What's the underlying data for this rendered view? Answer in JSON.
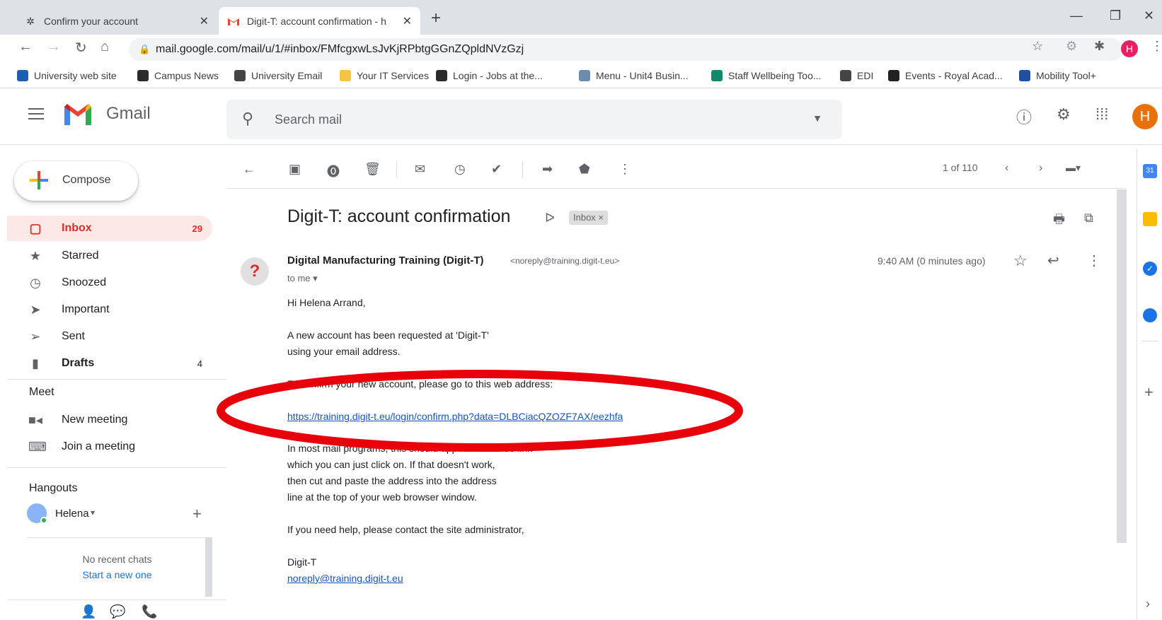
{
  "browser": {
    "tabs": [
      {
        "title": "Confirm your account",
        "icon": "settings-favicon"
      },
      {
        "title": "Digit-T: account confirmation - h",
        "icon": "gmail-favicon"
      }
    ],
    "url": "mail.google.com/mail/u/1/#inbox/FMfcgxwLsJvKjRPbtgGGnZQpldNVzGzj",
    "profile_initial": "H",
    "bookmarks": [
      {
        "label": "University web site",
        "color": "#1a5fb4"
      },
      {
        "label": "Campus News",
        "color": "#2b2b2b"
      },
      {
        "label": "University Email",
        "color": "#444444"
      },
      {
        "label": "Your IT Services",
        "color": "#f4c542"
      },
      {
        "label": "Login - Jobs at the...",
        "color": "#2b2b2b"
      },
      {
        "label": "Menu - Unit4 Busin...",
        "color": "#6a8caf"
      },
      {
        "label": "Staff Wellbeing Too...",
        "color": "#108a6a"
      },
      {
        "label": "EDI",
        "color": "#444444"
      },
      {
        "label": "Events - Royal Acad...",
        "color": "#222222"
      },
      {
        "label": "Mobility Tool+",
        "color": "#1f4fa0"
      }
    ]
  },
  "gmail": {
    "brand": "Gmail",
    "search_placeholder": "Search mail",
    "avatar_initial": "H",
    "compose_label": "Compose",
    "nav": [
      {
        "label": "Inbox",
        "count": "29",
        "icon": "inbox-icon"
      },
      {
        "label": "Starred",
        "count": "",
        "icon": "star-icon"
      },
      {
        "label": "Snoozed",
        "count": "",
        "icon": "clock-icon"
      },
      {
        "label": "Important",
        "count": "",
        "icon": "important-icon"
      },
      {
        "label": "Sent",
        "count": "",
        "icon": "send-icon"
      },
      {
        "label": "Drafts",
        "count": "4",
        "icon": "draft-icon"
      }
    ],
    "meet": {
      "heading": "Meet",
      "new_meeting": "New meeting",
      "join_meeting": "Join a meeting"
    },
    "hangouts": {
      "heading": "Hangouts",
      "user": "Helena",
      "no_chats": "No recent chats",
      "start_new": "Start a new one"
    },
    "toolbar": {
      "page_info": "1 of 110"
    },
    "email": {
      "subject": "Digit-T: account confirmation",
      "label_badge": "Inbox ×",
      "sender_name": "Digital Manufacturing Training (Digit-T)",
      "sender_email": "<noreply@training.digit-t.eu>",
      "to": "to me",
      "time": "9:40 AM (0 minutes ago)",
      "greeting": "Hi Helena Arrand,",
      "p1_l1": "A new account has been requested at 'Digit-T'",
      "p1_l2": "using your email address.",
      "p2": "To confirm your new account, please go to this web address:",
      "link": "https://training.digit-t.eu/login/confirm.php?data=DLBCiacQZOZF7AX/eezhfa",
      "p3_l1": "In most mail programs, this should appear as a blue link",
      "p3_l2": "which you can just click on. If that doesn't work,",
      "p3_l3": "then cut and paste the address into the address",
      "p3_l4": "line at the top of your web browser window.",
      "p4": "If you need help, please contact the site administrator,",
      "sig_name": "Digit-T",
      "sig_email": "noreply@training.digit-t.eu"
    }
  },
  "colors": {
    "annotation_oval": "#e8000b",
    "inbox_active": "#d93025",
    "link": "#1155cc"
  }
}
